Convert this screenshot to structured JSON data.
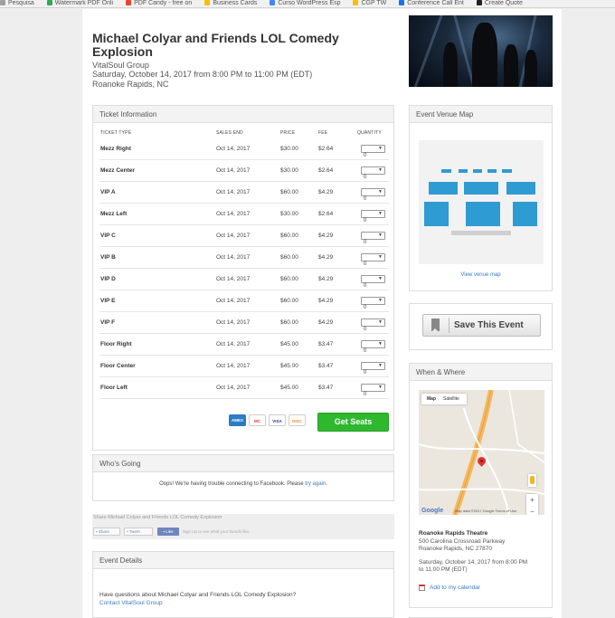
{
  "bookmarks": [
    {
      "label": "Pesquisa",
      "color": "#9aa0a6"
    },
    {
      "label": "Watermark PDF Onli",
      "color": "#34a853"
    },
    {
      "label": "PDF Candy - free on",
      "color": "#ea4335"
    },
    {
      "label": "Business Cards",
      "color": "#fbbc05"
    },
    {
      "label": "Curso WordPress Esp",
      "color": "#4285f4"
    },
    {
      "label": "CGP TW",
      "color": "#fbbc05"
    },
    {
      "label": "Conference Call Ent",
      "color": "#1a73e8"
    },
    {
      "label": "Create Quote",
      "color": "#202124"
    }
  ],
  "event": {
    "title": "Michael Colyar and Friends LOL Comedy Explosion",
    "organizer": "VitalSoul Group",
    "datetime": "Saturday, October 14, 2017 from 8:00 PM to 11:00 PM (EDT)",
    "location": "Roanoke Rapids, NC"
  },
  "tickets": {
    "heading": "Ticket Information",
    "columns": {
      "type": "TICKET TYPE",
      "sales_end": "SALES END",
      "price": "PRICE",
      "fee": "FEE",
      "quantity": "QUANTITY"
    },
    "rows": [
      {
        "name": "Mezz Right",
        "sales_end": "Oct 14, 2017",
        "price": "$30.00",
        "fee": "$2.64",
        "qty": "0"
      },
      {
        "name": "Mezz Center",
        "sales_end": "Oct 14, 2017",
        "price": "$30.00",
        "fee": "$2.64",
        "qty": "0"
      },
      {
        "name": "VIP A",
        "sales_end": "Oct 14, 2017",
        "price": "$60.00",
        "fee": "$4.29",
        "qty": "0"
      },
      {
        "name": "Mezz Left",
        "sales_end": "Oct 14, 2017",
        "price": "$30.00",
        "fee": "$2.64",
        "qty": "0"
      },
      {
        "name": "VIP C",
        "sales_end": "Oct 14, 2017",
        "price": "$60.00",
        "fee": "$4.29",
        "qty": "0"
      },
      {
        "name": "VIP B",
        "sales_end": "Oct 14, 2017",
        "price": "$60.00",
        "fee": "$4.29",
        "qty": "0"
      },
      {
        "name": "VIP D",
        "sales_end": "Oct 14, 2017",
        "price": "$60.00",
        "fee": "$4.29",
        "qty": "0"
      },
      {
        "name": "VIP E",
        "sales_end": "Oct 14, 2017",
        "price": "$60.00",
        "fee": "$4.29",
        "qty": "0"
      },
      {
        "name": "VIP F",
        "sales_end": "Oct 14, 2017",
        "price": "$60.00",
        "fee": "$4.29",
        "qty": "0"
      },
      {
        "name": "Floor Right",
        "sales_end": "Oct 14, 2017",
        "price": "$45.00",
        "fee": "$3.47",
        "qty": "0"
      },
      {
        "name": "Floor Center",
        "sales_end": "Oct 14, 2017",
        "price": "$45.00",
        "fee": "$3.47",
        "qty": "0"
      },
      {
        "name": "Floor Left",
        "sales_end": "Oct 14, 2017",
        "price": "$45.00",
        "fee": "$3.47",
        "qty": "0"
      }
    ],
    "cards": [
      "AMEX",
      "MC",
      "VISA",
      "DISC"
    ],
    "get_seats_label": "Get Seats"
  },
  "whos_going": {
    "heading": "Who's Going",
    "message": "Oops! We're having trouble connecting to Facebook. Please",
    "retry_link": "try again",
    "message_end": "."
  },
  "share": {
    "title": "Share Michael Colyar and Friends LOL Comedy Explosion",
    "share_label": "Share",
    "tweet_label": "Tweet",
    "like_label": "Like",
    "like_note": "Sign Up to see what your friends like."
  },
  "details": {
    "heading": "Event Details",
    "question": "Have questions about Michael Colyar and Friends LOL Comedy Explosion?",
    "contact_link": "Contact VitalSoul Group"
  },
  "venue_map": {
    "heading": "Event Venue Map",
    "link": "View venue map"
  },
  "save": {
    "label": "Save This Event"
  },
  "when_where": {
    "heading": "When & Where",
    "map_tab": "Map",
    "satellite_tab": "Satellite",
    "map_footer": "Map data ©2017 Google  Terms of Use",
    "google": "Google",
    "zoom_in": "+",
    "zoom_out": "−",
    "venue_name": "Roanoke Rapids Theatre",
    "address1": "500 Carolina Crossroad Parkway",
    "address2": "Roanoke Rapids, NC 27870",
    "time1": "Saturday, October 14, 2017 from 8:00 PM",
    "time2": "to 11:00 PM (EDT)",
    "calendar_link": "Add to my calendar"
  }
}
